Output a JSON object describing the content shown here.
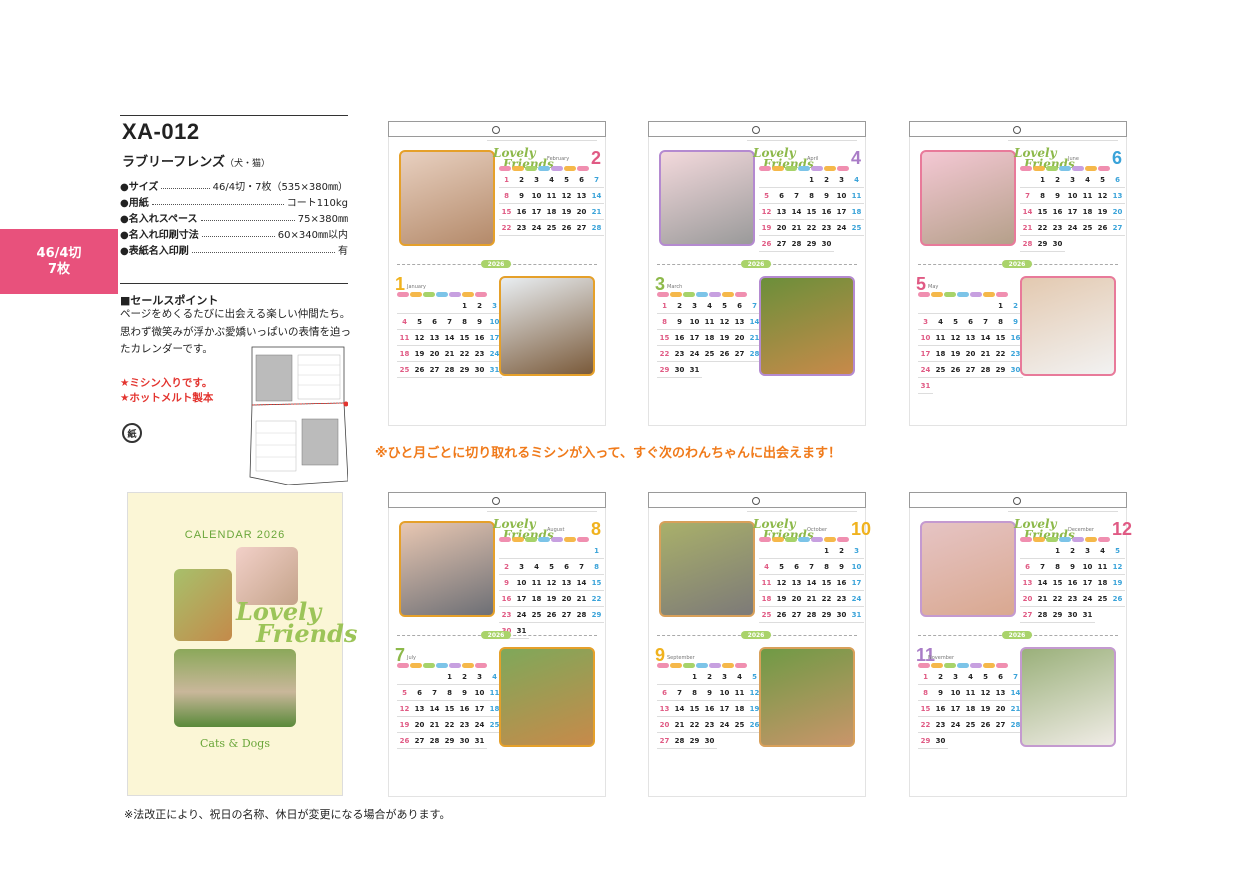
{
  "side_tab": {
    "line1": "46/4切",
    "line2": "7枚"
  },
  "product": {
    "code": "XA-012",
    "name": "ラブリーフレンズ",
    "name_sub": "（犬・猫）",
    "specs": [
      {
        "key": "●サイズ",
        "value": "46/4切・7枚（535×380㎜）"
      },
      {
        "key": "●用紙",
        "value": "コート110kg"
      },
      {
        "key": "●名入れスペース",
        "value": "75×380㎜"
      },
      {
        "key": "●名入れ印刷寸法",
        "value": "60×340㎜以内"
      },
      {
        "key": "●表紙名入印刷",
        "value": "有"
      }
    ]
  },
  "sales": {
    "title": "■セールスポイント",
    "text": "ページをめくるたびに出会える楽しい仲間たち。思わず微笑みが浮かぶ愛嬌いっぱいの表情を迫ったカレンダーです。",
    "red_1": "★ミシン入りです。",
    "red_2": "★ホットメルト製本",
    "recycle_label": "紙"
  },
  "perforation_note": "※ひと月ごとに切り取れるミシンが入って、すぐ次のわんちゃんに出会えます！",
  "footer_note": "※法改正により、祝日の名称、休日が変更になる場合があります。",
  "cover": {
    "title": "CALENDAR 2026",
    "logo_1": "Lovely",
    "logo_2": "Friends",
    "subtitle": "Cats & Dogs"
  },
  "year_label": "2026",
  "logo": {
    "line1": "Lovely",
    "line2": "Friends"
  },
  "calendar_pages": [
    {
      "top": {
        "num": "2",
        "name": "February",
        "color": "#e05a84",
        "days": [
          "1",
          "2",
          "3",
          "4",
          "5",
          "6",
          "7",
          "8",
          "9",
          "10",
          "11",
          "12",
          "13",
          "14",
          "15",
          "16",
          "17",
          "18",
          "19",
          "20",
          "21",
          "22",
          "23",
          "24",
          "25",
          "26",
          "27",
          "28"
        ],
        "offset": 0
      },
      "bottom": {
        "num": "1",
        "name": "January",
        "color": "#f0b21e",
        "days": [
          "1",
          "2",
          "3",
          "4",
          "5",
          "6",
          "7",
          "8",
          "9",
          "10",
          "11",
          "12",
          "13",
          "14",
          "15",
          "16",
          "17",
          "18",
          "19",
          "20",
          "21",
          "22",
          "23",
          "24",
          "25",
          "26",
          "27",
          "28",
          "29",
          "30",
          "31"
        ],
        "offset": 4
      }
    },
    {
      "top": {
        "num": "4",
        "name": "April",
        "color": "#a97cc7",
        "days": [
          "1",
          "2",
          "3",
          "4",
          "5",
          "6",
          "7",
          "8",
          "9",
          "10",
          "11",
          "12",
          "13",
          "14",
          "15",
          "16",
          "17",
          "18",
          "19",
          "20",
          "21",
          "22",
          "23",
          "24",
          "25",
          "26",
          "27",
          "28",
          "29",
          "30"
        ],
        "offset": 3
      },
      "bottom": {
        "num": "3",
        "name": "March",
        "color": "#8db94a",
        "days": [
          "1",
          "2",
          "3",
          "4",
          "5",
          "6",
          "7",
          "8",
          "9",
          "10",
          "11",
          "12",
          "13",
          "14",
          "15",
          "16",
          "17",
          "18",
          "19",
          "20",
          "21",
          "22",
          "23",
          "24",
          "25",
          "26",
          "27",
          "28",
          "29",
          "30",
          "31"
        ],
        "offset": 0
      }
    },
    {
      "top": {
        "num": "6",
        "name": "June",
        "color": "#3aa3d9",
        "days": [
          "1",
          "2",
          "3",
          "4",
          "5",
          "6",
          "7",
          "8",
          "9",
          "10",
          "11",
          "12",
          "13",
          "14",
          "15",
          "16",
          "17",
          "18",
          "19",
          "20",
          "21",
          "22",
          "23",
          "24",
          "25",
          "26",
          "27",
          "28",
          "29",
          "30"
        ],
        "offset": 1
      },
      "bottom": {
        "num": "5",
        "name": "May",
        "color": "#e05a84",
        "days": [
          "1",
          "2",
          "3",
          "4",
          "5",
          "6",
          "7",
          "8",
          "9",
          "10",
          "11",
          "12",
          "13",
          "14",
          "15",
          "16",
          "17",
          "18",
          "19",
          "20",
          "21",
          "22",
          "23",
          "24",
          "25",
          "26",
          "27",
          "28",
          "29",
          "30",
          "31"
        ],
        "offset": 5
      }
    },
    {
      "top": {
        "num": "8",
        "name": "August",
        "color": "#f0b21e",
        "days": [
          "1",
          "2",
          "3",
          "4",
          "5",
          "6",
          "7",
          "8",
          "9",
          "10",
          "11",
          "12",
          "13",
          "14",
          "15",
          "16",
          "17",
          "18",
          "19",
          "20",
          "21",
          "22",
          "23",
          "24",
          "25",
          "26",
          "27",
          "28",
          "29",
          "30",
          "31"
        ],
        "offset": 6
      },
      "bottom": {
        "num": "7",
        "name": "July",
        "color": "#8db94a",
        "days": [
          "1",
          "2",
          "3",
          "4",
          "5",
          "6",
          "7",
          "8",
          "9",
          "10",
          "11",
          "12",
          "13",
          "14",
          "15",
          "16",
          "17",
          "18",
          "19",
          "20",
          "21",
          "22",
          "23",
          "24",
          "25",
          "26",
          "27",
          "28",
          "29",
          "30",
          "31"
        ],
        "offset": 3
      }
    },
    {
      "top": {
        "num": "10",
        "name": "October",
        "color": "#f0b21e",
        "days": [
          "1",
          "2",
          "3",
          "4",
          "5",
          "6",
          "7",
          "8",
          "9",
          "10",
          "11",
          "12",
          "13",
          "14",
          "15",
          "16",
          "17",
          "18",
          "19",
          "20",
          "21",
          "22",
          "23",
          "24",
          "25",
          "26",
          "27",
          "28",
          "29",
          "30",
          "31"
        ],
        "offset": 4
      },
      "bottom": {
        "num": "9",
        "name": "September",
        "color": "#f0b21e",
        "days": [
          "1",
          "2",
          "3",
          "4",
          "5",
          "6",
          "7",
          "8",
          "9",
          "10",
          "11",
          "12",
          "13",
          "14",
          "15",
          "16",
          "17",
          "18",
          "19",
          "20",
          "21",
          "22",
          "23",
          "24",
          "25",
          "26",
          "27",
          "28",
          "29",
          "30"
        ],
        "offset": 2
      }
    },
    {
      "top": {
        "num": "12",
        "name": "December",
        "color": "#e05a84",
        "days": [
          "1",
          "2",
          "3",
          "4",
          "5",
          "6",
          "7",
          "8",
          "9",
          "10",
          "11",
          "12",
          "13",
          "14",
          "15",
          "16",
          "17",
          "18",
          "19",
          "20",
          "21",
          "22",
          "23",
          "24",
          "25",
          "26",
          "27",
          "28",
          "29",
          "30",
          "31"
        ],
        "offset": 2
      },
      "bottom": {
        "num": "11",
        "name": "November",
        "color": "#a97cc7",
        "days": [
          "1",
          "2",
          "3",
          "4",
          "5",
          "6",
          "7",
          "8",
          "9",
          "10",
          "11",
          "12",
          "13",
          "14",
          "15",
          "16",
          "17",
          "18",
          "19",
          "20",
          "21",
          "22",
          "23",
          "24",
          "25",
          "26",
          "27",
          "28",
          "29",
          "30"
        ],
        "offset": 0
      }
    }
  ],
  "colors": {
    "accent_pink": "#e8517c",
    "perforation_orange": "#f07a1a",
    "red_note": "#e3342f",
    "logo_green": "#8db94a",
    "sunday": "#e05a84",
    "saturday": "#3aa3d9"
  },
  "icons": [
    "recycle-paper-icon",
    "hanger-hole-icon",
    "dog-photo",
    "cat-photo"
  ]
}
